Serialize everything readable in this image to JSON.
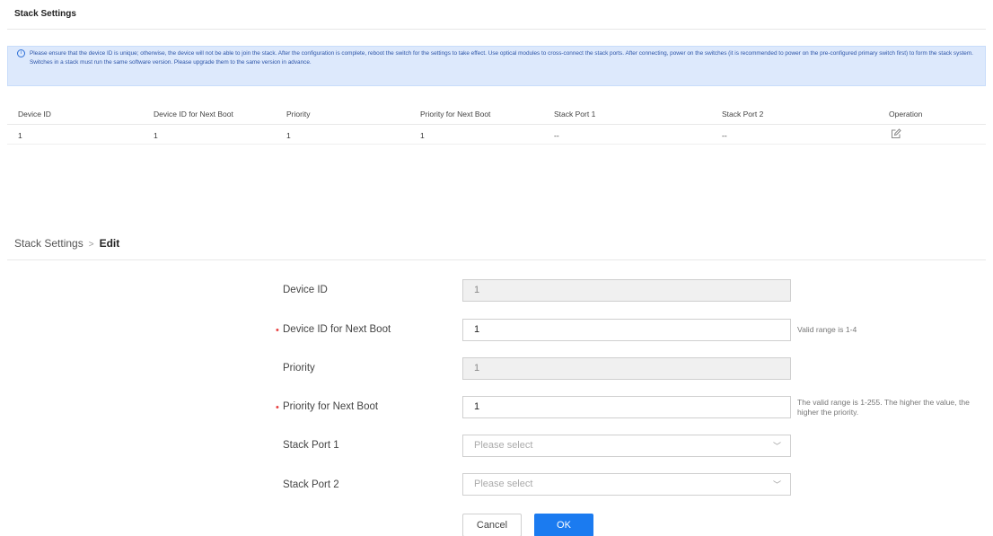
{
  "page": {
    "title": "Stack Settings"
  },
  "notice": {
    "line1": "Please ensure that the device ID is unique; otherwise, the device will not be able to join the stack. After the configuration is complete, reboot the switch for the settings to take effect. Use optical modules to cross-connect the stack ports. After connecting, power on the switches (it is recommended to power on the pre-configured primary switch first) to form the stack system.",
    "line2": "Switches in a stack must run the same software version. Please upgrade them to the same version in advance."
  },
  "table": {
    "headers": [
      "Device ID",
      "Device ID for Next Boot",
      "Priority",
      "Priority for Next Boot",
      "Stack Port 1",
      "Stack Port 2",
      "Operation"
    ],
    "rows": [
      [
        "1",
        "1",
        "1",
        "1",
        "--",
        "--"
      ]
    ]
  },
  "breadcrumb": {
    "parent": "Stack Settings",
    "separator": ">",
    "current": "Edit"
  },
  "form": {
    "device_id": {
      "label": "Device ID",
      "value": "1"
    },
    "device_id_next_boot": {
      "label": "Device ID for Next Boot",
      "value": "1",
      "hint": "Valid range is 1-4"
    },
    "priority": {
      "label": "Priority",
      "value": "1"
    },
    "priority_next_boot": {
      "label": "Priority for Next Boot",
      "value": "1",
      "hint": "The valid range is 1-255. The higher the value, the higher the priority."
    },
    "stack_port_1": {
      "label": "Stack Port 1",
      "placeholder": "Please select"
    },
    "stack_port_2": {
      "label": "Stack Port 2",
      "placeholder": "Please select"
    }
  },
  "buttons": {
    "cancel": "Cancel",
    "ok": "OK"
  },
  "icons": {
    "info": "info-icon",
    "edit": "edit-icon",
    "chevron": "chevron-down-icon",
    "required": "required-asterisk"
  },
  "colors": {
    "accent": "#1b7bf0",
    "notice_bg": "#dde9fc",
    "required": "#e84040"
  }
}
